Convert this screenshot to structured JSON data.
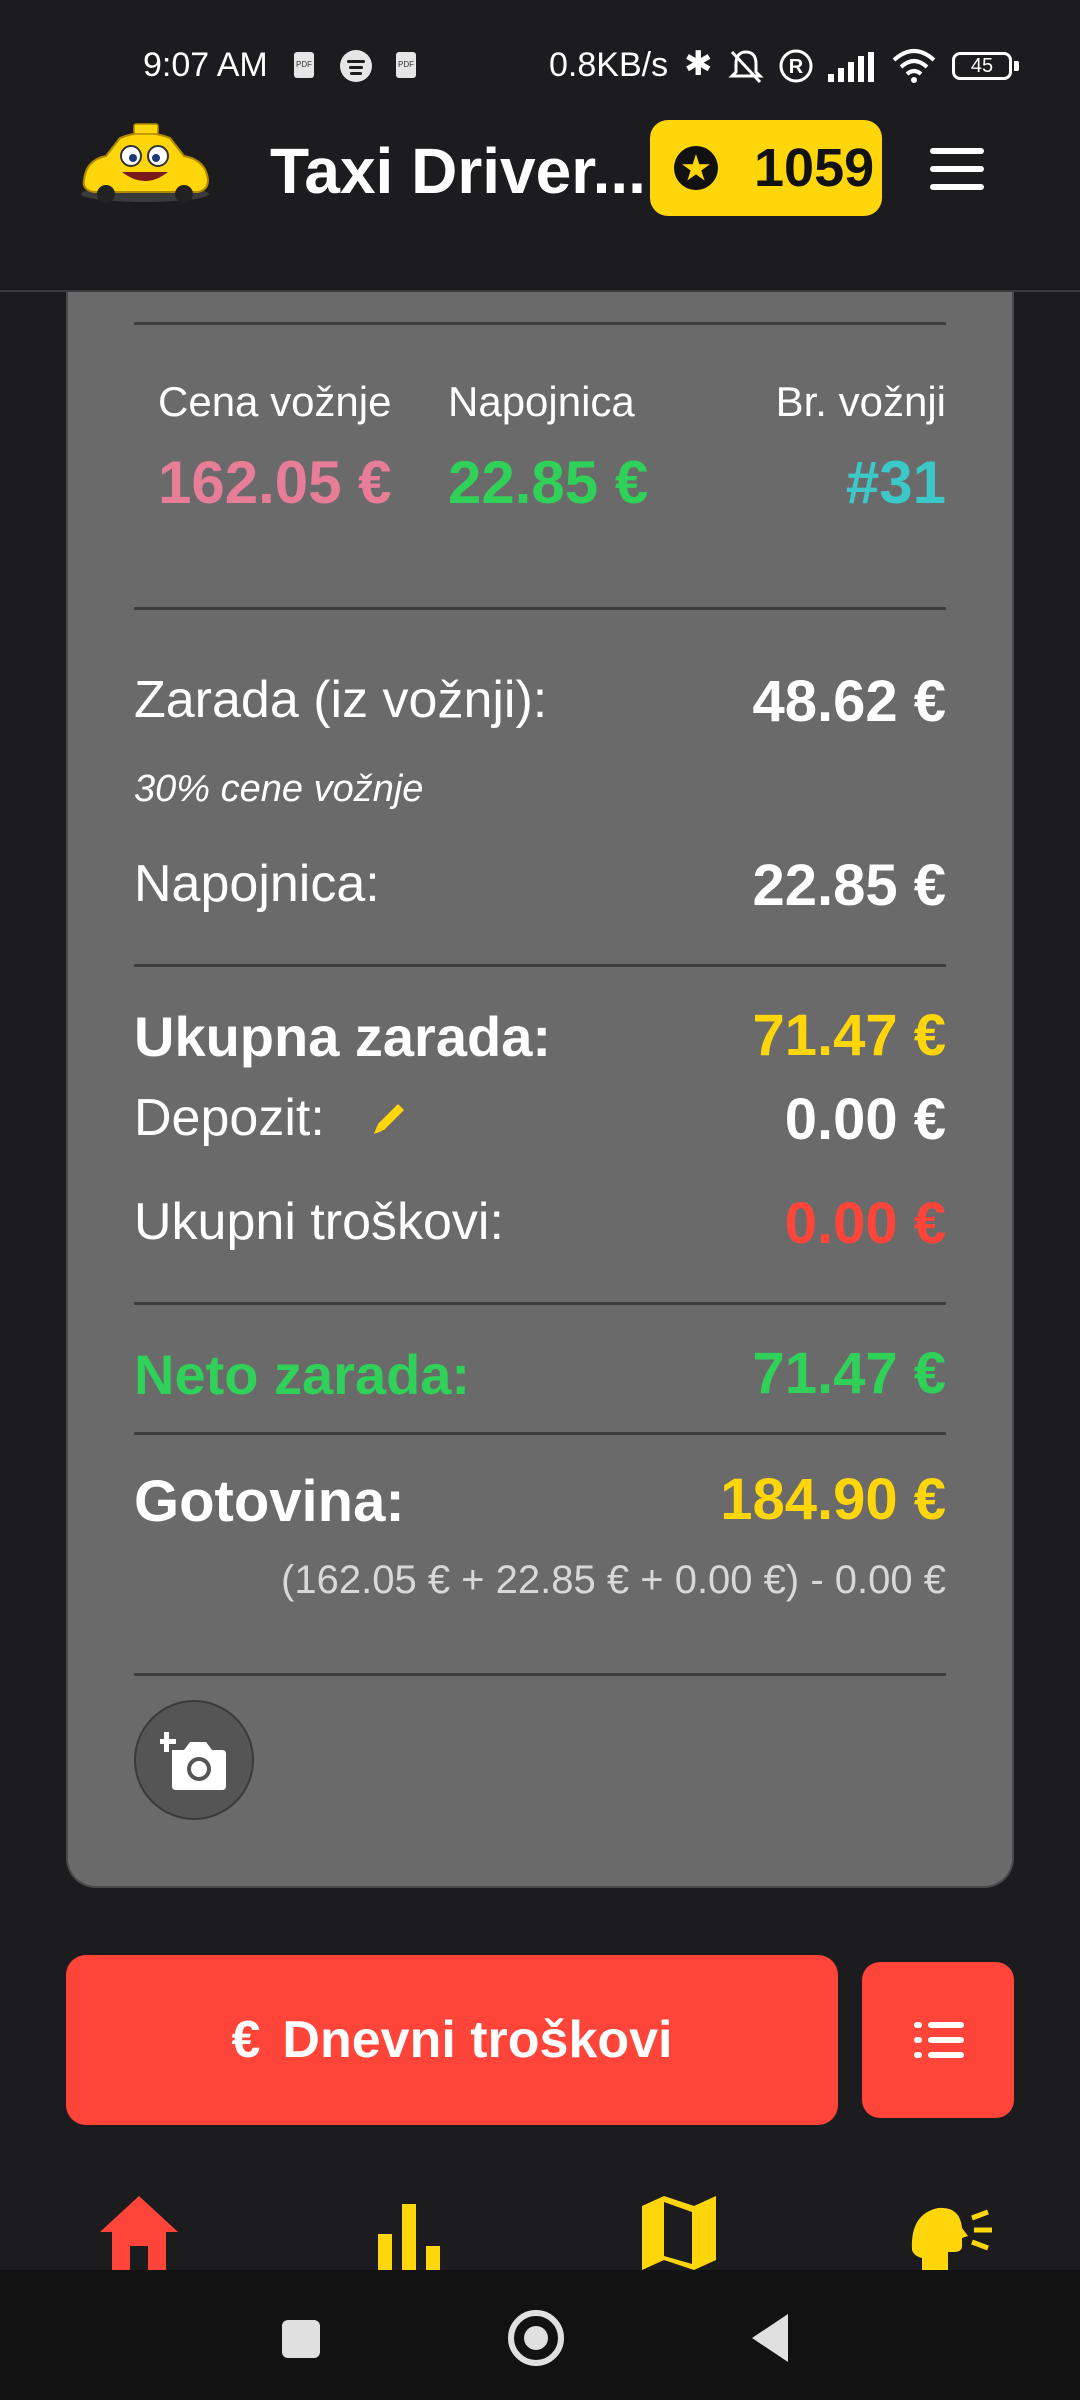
{
  "status_bar": {
    "time": "9:07 AM",
    "speed": "0.8KB/s",
    "battery": "45",
    "icons": [
      "pdf-icon",
      "spotify-icon",
      "pdf-icon",
      "bluetooth-icon",
      "bell-off-icon",
      "registered-icon",
      "signal-icon",
      "wifi-icon",
      "battery-icon"
    ]
  },
  "header": {
    "title": "Taxi Driver...",
    "points": "1059",
    "points_icon": "star-icon",
    "menu_icon": "hamburger-menu-icon"
  },
  "summary": {
    "fare_label": "Cena vožnje",
    "fare_value": "162.05 €",
    "tip_label": "Napojnica",
    "tip_value": "22.85 €",
    "rides_label": "Br. vožnji",
    "rides_value": "#31"
  },
  "breakdown": {
    "earnings_label": "Zarada (iz vožnji):",
    "earnings_value": "48.62 €",
    "earnings_note": "30% cene vožnje",
    "tip_label": "Napojnica:",
    "tip_value": "22.85 €",
    "total_label": "Ukupna zarada:",
    "total_value": "71.47 €",
    "deposit_label": "Depozit:",
    "deposit_value": "0.00 €",
    "expenses_label": "Ukupni troškovi:",
    "expenses_value": "0.00 €",
    "net_label": "Neto zarada:",
    "net_value": "71.47 €",
    "cash_label": "Gotovina:",
    "cash_value": "184.90 €",
    "cash_formula": "(162.05 € + 22.85 € + 0.00 €) - 0.00 €"
  },
  "actions": {
    "expenses_button": "Dnevni troškovi",
    "expenses_icon": "euro-icon",
    "list_icon": "list-icon",
    "camera_icon": "add-photo-icon"
  },
  "bottom_nav": [
    "home-icon",
    "stats-icon",
    "map-icon",
    "voice-icon"
  ],
  "colors": {
    "background": "#1c1c1e",
    "card": "#6a6a6a",
    "fare": "#e87d98",
    "green": "#30d158",
    "teal": "#3cc8c8",
    "yellow": "#ffd60a",
    "red": "#ff453a"
  }
}
